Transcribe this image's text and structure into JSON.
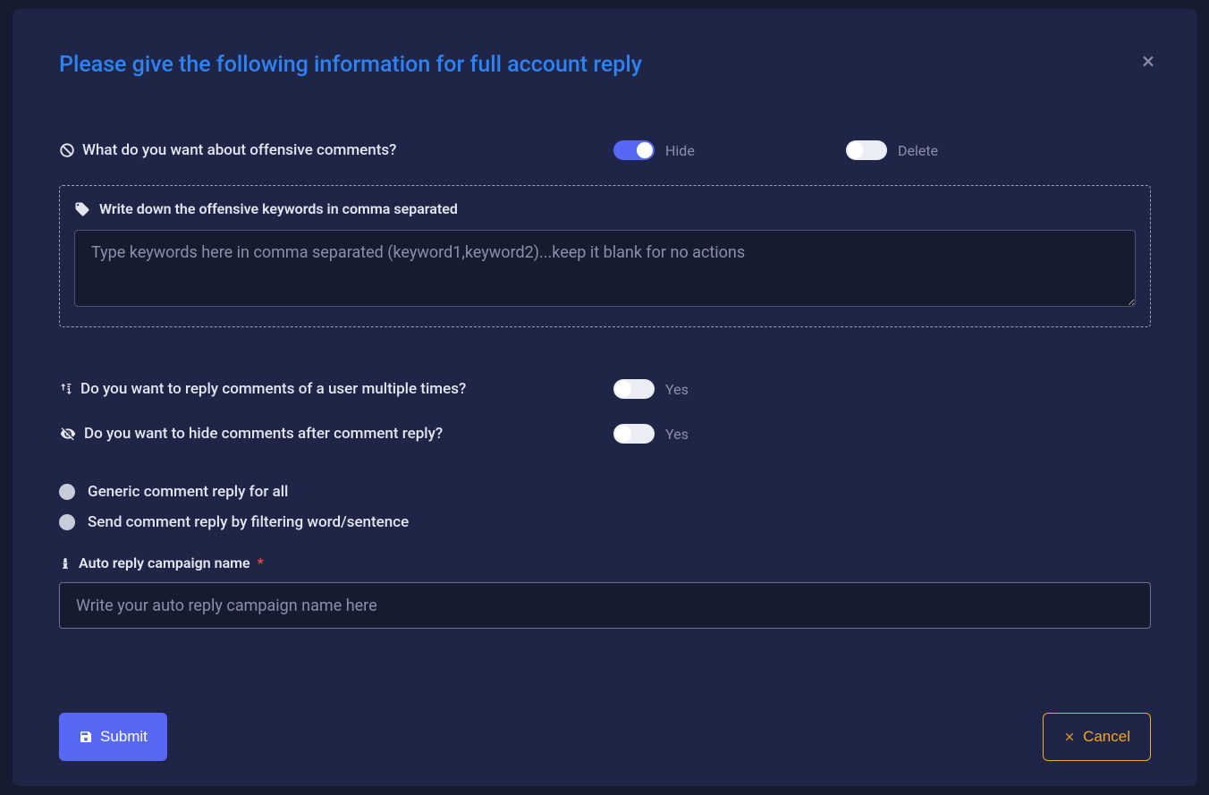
{
  "modal": {
    "title": "Please give the following information for full account reply",
    "close_icon": "×"
  },
  "offensive": {
    "question": "What do you want about offensive comments?",
    "hide_label": "Hide",
    "delete_label": "Delete",
    "keywords_label": "Write down the offensive keywords in comma separated",
    "keywords_placeholder": "Type keywords here in comma separated (keyword1,keyword2)...keep it blank for no actions"
  },
  "reply_multiple": {
    "question": "Do you want to reply comments of a user multiple times?",
    "label": "Yes"
  },
  "hide_after": {
    "question": "Do you want to hide comments after comment reply?",
    "label": "Yes"
  },
  "reply_type": {
    "generic": "Generic comment reply for all",
    "filter": "Send comment reply by filtering word/sentence"
  },
  "campaign": {
    "label": "Auto reply campaign name",
    "placeholder": "Write your auto reply campaign name here"
  },
  "buttons": {
    "submit": "Submit",
    "cancel": "Cancel"
  }
}
